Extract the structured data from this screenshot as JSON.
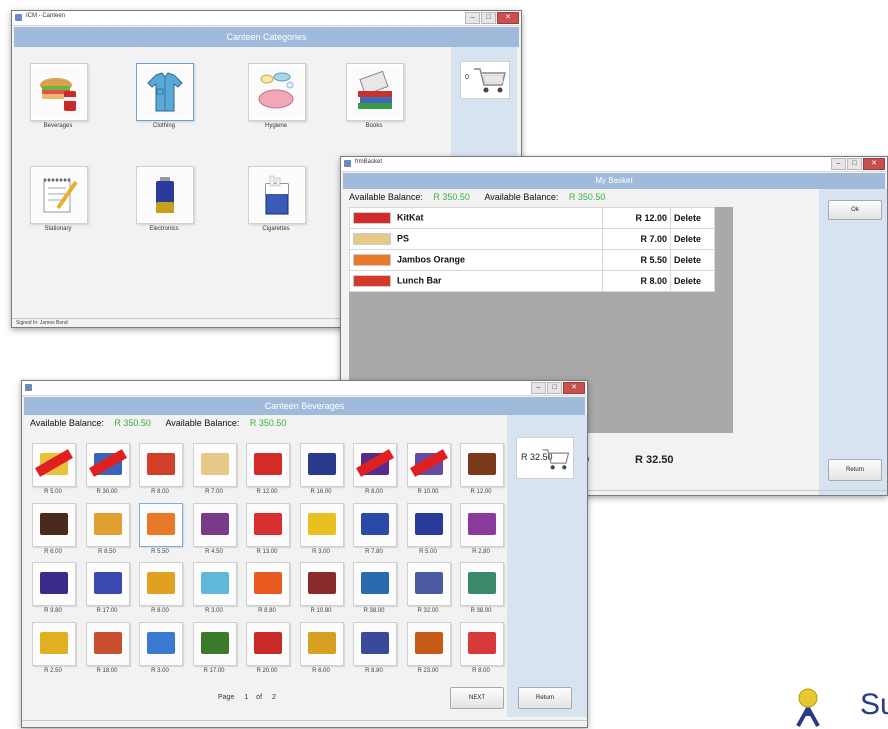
{
  "categories_window": {
    "title": "ICM - Canteen",
    "header": "Canteen Categories",
    "status": "Signed In: James Bond",
    "cart_count": "0",
    "categories": [
      {
        "label": "Beverages",
        "icon": "sandwich-drink-icon"
      },
      {
        "label": "Clothing",
        "icon": "shirt-icon"
      },
      {
        "label": "Hygiene",
        "icon": "soap-icon"
      },
      {
        "label": "Books",
        "icon": "books-icon"
      },
      {
        "label": "Stationary",
        "icon": "notepad-pencil-icon"
      },
      {
        "label": "Electronics",
        "icon": "battery-icon"
      },
      {
        "label": "Cigarettes",
        "icon": "cigarette-pack-icon"
      }
    ]
  },
  "basket_window": {
    "title": "frmBasket",
    "header": "My Basket",
    "balance_label": "Available Balance:",
    "balance_value": "R 350.50",
    "balance_label_2": "Available Balance:",
    "balance_value_2": "R 350.50",
    "ok_label": "Ok",
    "return_label": "Return",
    "total_partial": "0",
    "total": "R 32.50",
    "delete_label": "Delete",
    "items": [
      {
        "name": "KitKat",
        "price": "R 12.00",
        "color": "#d32a2a"
      },
      {
        "name": "PS",
        "price": "R 7.00",
        "color": "#e7c98a"
      },
      {
        "name": "Jambos Orange",
        "price": "R 5.50",
        "color": "#e8782a"
      },
      {
        "name": "Lunch Bar",
        "price": "R 8.00",
        "color": "#d33a2a"
      }
    ]
  },
  "beverages_window": {
    "header": "Canteen Beverages",
    "balance_label": "Available Balance:",
    "balance_value": "R 350.50",
    "balance_label_2": "Available Balance:",
    "balance_value_2": "R 350.50",
    "cart_total": "R 32.50",
    "page_label": "Page",
    "page_current": "1",
    "page_of": "of",
    "page_total": "2",
    "next_label": "NEXT",
    "return_label": "Return",
    "products": [
      {
        "price": "R 5.00",
        "sold_out": true,
        "color": "#e8c23a"
      },
      {
        "price": "R 30.00",
        "sold_out": true,
        "color": "#3a62b8"
      },
      {
        "price": "R 8.00",
        "sold_out": false,
        "color": "#d3402a"
      },
      {
        "price": "R 7.00",
        "sold_out": false,
        "color": "#e7c98a"
      },
      {
        "price": "R 12.00",
        "sold_out": false,
        "color": "#d32a2a"
      },
      {
        "price": "R 16.00",
        "sold_out": false,
        "color": "#2a3a8a"
      },
      {
        "price": "R 8.00",
        "sold_out": true,
        "color": "#5a2a8a"
      },
      {
        "price": "R 10.00",
        "sold_out": true,
        "color": "#6a4aa0"
      },
      {
        "price": "R 12.00",
        "sold_out": false,
        "color": "#7a3a1a"
      },
      {
        "price": "R 6.00",
        "sold_out": false,
        "color": "#4a2a1a"
      },
      {
        "price": "R 8.50",
        "sold_out": false,
        "color": "#e0a030"
      },
      {
        "price": "R 5.50",
        "sold_out": false,
        "color": "#e8782a"
      },
      {
        "price": "R 4.50",
        "sold_out": false,
        "color": "#7a3a8a"
      },
      {
        "price": "R 13.00",
        "sold_out": false,
        "color": "#d83030"
      },
      {
        "price": "R 3.00",
        "sold_out": false,
        "color": "#e8c020"
      },
      {
        "price": "R 7.80",
        "sold_out": false,
        "color": "#2a4aa8"
      },
      {
        "price": "R 5.00",
        "sold_out": false,
        "color": "#2a3a9a"
      },
      {
        "price": "R 2.80",
        "sold_out": false,
        "color": "#8a3a9a"
      },
      {
        "price": "R 9.80",
        "sold_out": false,
        "color": "#3a2a8a"
      },
      {
        "price": "R 17.00",
        "sold_out": false,
        "color": "#3a4ab0"
      },
      {
        "price": "R 8.00",
        "sold_out": false,
        "color": "#e0a020"
      },
      {
        "price": "R 3.00",
        "sold_out": false,
        "color": "#60b8d8"
      },
      {
        "price": "R 8.80",
        "sold_out": false,
        "color": "#e85a20"
      },
      {
        "price": "R 10.80",
        "sold_out": false,
        "color": "#8a2a2a"
      },
      {
        "price": "R 38.00",
        "sold_out": false,
        "color": "#2a6ab0"
      },
      {
        "price": "R 32.00",
        "sold_out": false,
        "color": "#4a5aa0"
      },
      {
        "price": "R 38.00",
        "sold_out": false,
        "color": "#3a8a6a"
      },
      {
        "price": "R 2.50",
        "sold_out": false,
        "color": "#e0b020"
      },
      {
        "price": "R 18.00",
        "sold_out": false,
        "color": "#c85030"
      },
      {
        "price": "R 3.00",
        "sold_out": false,
        "color": "#3a7ad0"
      },
      {
        "price": "R 17.00",
        "sold_out": false,
        "color": "#3a7a2a"
      },
      {
        "price": "R 20.00",
        "sold_out": false,
        "color": "#c82a2a"
      },
      {
        "price": "R 6.00",
        "sold_out": false,
        "color": "#d8a020"
      },
      {
        "price": "R 8.80",
        "sold_out": false,
        "color": "#3a4a9a"
      },
      {
        "price": "R 23.00",
        "sold_out": false,
        "color": "#c85a1a"
      },
      {
        "price": "R 8.00",
        "sold_out": false,
        "color": "#d83a3a"
      }
    ]
  },
  "corner": {
    "text": "Su",
    "color": "#2a3a8a",
    "icon": "person-logo-icon"
  }
}
